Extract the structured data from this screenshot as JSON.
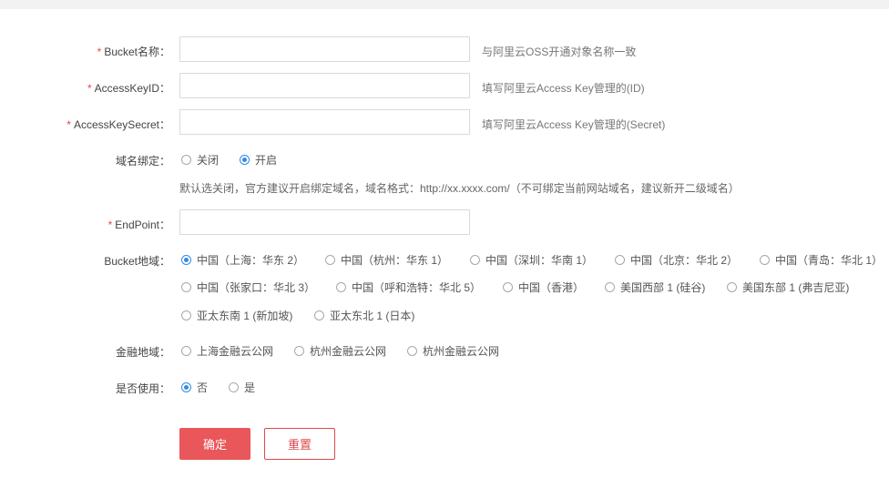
{
  "form": {
    "bucket_name": {
      "label": "Bucket名称：",
      "required": true,
      "value": "",
      "hint": "与阿里云OSS开通对象名称一致"
    },
    "access_key_id": {
      "label": "AccessKeyID：",
      "required": true,
      "value": "",
      "hint": "填写阿里云Access Key管理的(ID)"
    },
    "access_key_secret": {
      "label": "AccessKeySecret：",
      "required": true,
      "value": "",
      "hint": "填写阿里云Access Key管理的(Secret)"
    },
    "domain_binding": {
      "label": "域名绑定：",
      "options": [
        "关闭",
        "开启"
      ],
      "selected": "开启",
      "note": "默认选关闭，官方建议开启绑定域名，域名格式：http://xx.xxxx.com/（不可绑定当前网站域名，建议新开二级域名）"
    },
    "endpoint": {
      "label": "EndPoint：",
      "required": true,
      "value": ""
    },
    "bucket_region": {
      "label": "Bucket地域：",
      "options": [
        "中国（上海：华东 2）",
        "中国（杭州：华东 1）",
        "中国（深圳：华南 1）",
        "中国（北京：华北 2）",
        "中国（青岛：华北 1）",
        "中国（张家口：华北 3）",
        "中国（呼和浩特：华北 5）",
        "中国（香港）",
        "美国西部 1 (硅谷)",
        "美国东部 1 (弗吉尼亚)",
        "亚太东南 1 (新加坡)",
        "亚太东北 1 (日本)"
      ],
      "selected": "中国（上海：华东 2）"
    },
    "finance_region": {
      "label": "金融地域：",
      "options": [
        "上海金融云公网",
        "杭州金融云公网",
        "杭州金融云公网"
      ],
      "selected": ""
    },
    "enabled": {
      "label": "是否使用：",
      "options": [
        "否",
        "是"
      ],
      "selected": "否"
    },
    "buttons": {
      "submit": "确定",
      "reset": "重置"
    }
  },
  "colors": {
    "accent": "#e9575a",
    "radio_selected": "#2e8ae6",
    "required_mark": "#e0484c"
  }
}
